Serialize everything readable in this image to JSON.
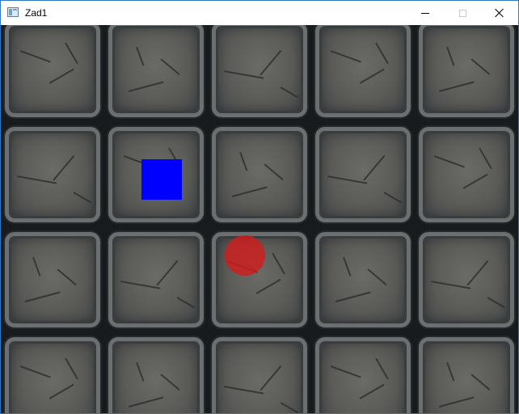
{
  "window": {
    "title": "Zad1",
    "icon": "app-window-icon",
    "controls": [
      "minimize-icon",
      "maximize-icon",
      "close-icon"
    ]
  },
  "game": {
    "board": {
      "rows": 4,
      "columns": 5,
      "tile_style": "cracked stone slabs"
    },
    "player": {
      "shape": "square",
      "color": "#0000ff",
      "row": 2,
      "column": 2
    },
    "orb": {
      "shape": "circle",
      "color": "#d61a1a",
      "row": 3,
      "column": 3
    }
  }
}
